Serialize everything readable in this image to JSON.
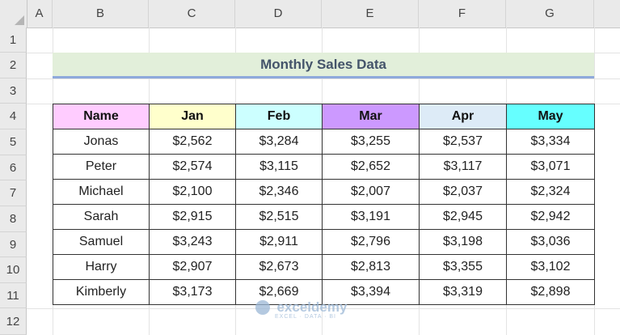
{
  "columns": [
    "A",
    "B",
    "C",
    "D",
    "E",
    "F",
    "G"
  ],
  "rows": [
    "1",
    "2",
    "3",
    "4",
    "5",
    "6",
    "7",
    "8",
    "9",
    "10",
    "11",
    "12"
  ],
  "title": "Monthly Sales Data",
  "headers": [
    "Name",
    "Jan",
    "Feb",
    "Mar",
    "Apr",
    "May"
  ],
  "header_colors": [
    "#ffccff",
    "#ffffcc",
    "#ccffff",
    "#cc99ff",
    "#ddebf7",
    "#66ffff"
  ],
  "data": [
    [
      "Jonas",
      "$2,562",
      "$3,284",
      "$3,255",
      "$2,537",
      "$3,334"
    ],
    [
      "Peter",
      "$2,574",
      "$3,115",
      "$2,652",
      "$3,117",
      "$3,071"
    ],
    [
      "Michael",
      "$2,100",
      "$2,346",
      "$2,007",
      "$2,037",
      "$2,324"
    ],
    [
      "Sarah",
      "$2,915",
      "$2,515",
      "$3,191",
      "$2,945",
      "$2,942"
    ],
    [
      "Samuel",
      "$3,243",
      "$2,911",
      "$2,796",
      "$3,198",
      "$3,036"
    ],
    [
      "Harry",
      "$2,907",
      "$2,673",
      "$2,813",
      "$3,355",
      "$3,102"
    ],
    [
      "Kimberly",
      "$3,173",
      "$2,669",
      "$3,394",
      "$3,319",
      "$2,898"
    ]
  ],
  "watermark": {
    "name": "exceldemy",
    "tagline": "EXCEL · DATA · BI"
  }
}
